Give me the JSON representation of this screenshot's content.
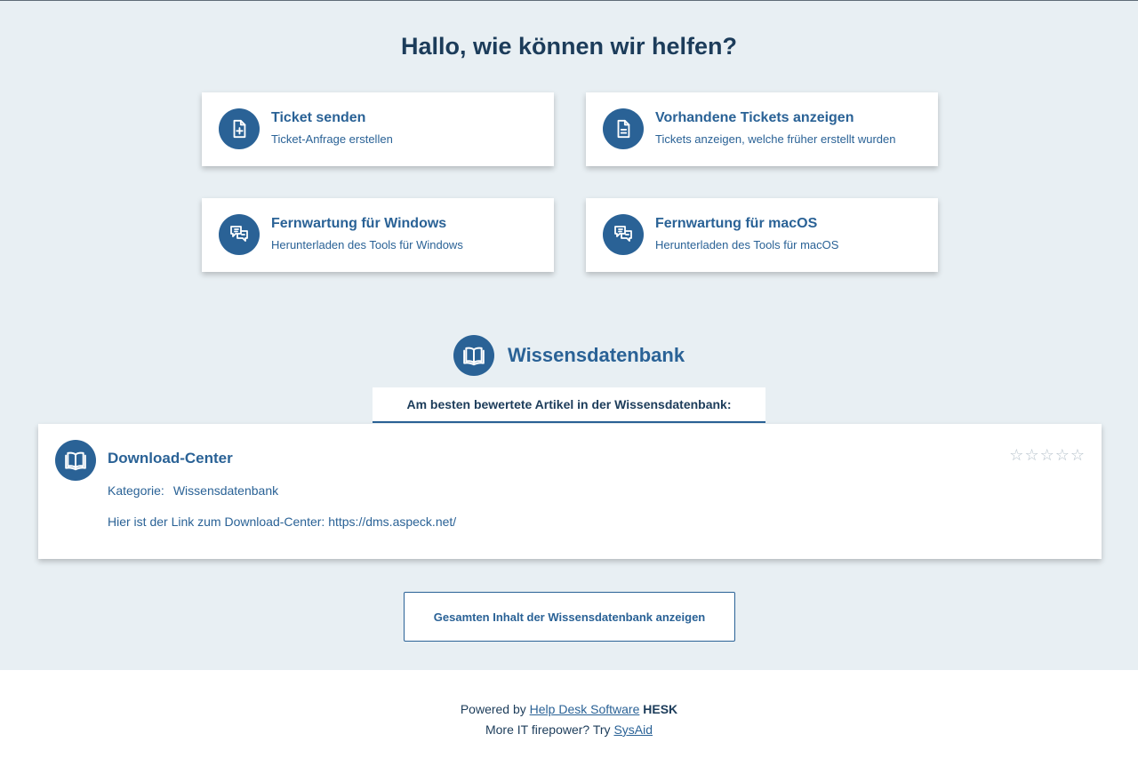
{
  "colors": {
    "primary": "#2a6296",
    "heading": "#1c3c5a",
    "background": "#e8eff3",
    "card": "#ffffff"
  },
  "page_title": "Hallo, wie können wir helfen?",
  "nav_cards": [
    {
      "icon": "file-plus-icon",
      "title": "Ticket senden",
      "subtitle": "Ticket-Anfrage erstellen"
    },
    {
      "icon": "file-text-icon",
      "title": "Vorhandene Tickets anzeigen",
      "subtitle": "Tickets anzeigen, welche früher erstellt wurden"
    },
    {
      "icon": "chat-bubbles-icon",
      "title": "Fernwartung für Windows",
      "subtitle": "Herunterladen des Tools für Windows"
    },
    {
      "icon": "chat-bubbles-icon",
      "title": "Fernwartung für macOS",
      "subtitle": "Herunterladen des Tools für macOS"
    }
  ],
  "knowledgebase": {
    "icon": "open-book-icon",
    "title": "Wissensdatenbank",
    "tab_label": "Am besten bewertete Artikel in der Wissensdatenbank:",
    "article": {
      "icon": "open-book-icon",
      "title": "Download-Center",
      "category_label": "Kategorie:",
      "category_value": "Wissensdatenbank",
      "text": "Hier ist der Link zum Download-Center: https://dms.aspeck.net/",
      "rating_stars_total": 5,
      "rating_stars_filled": 0,
      "star_glyph": "☆"
    },
    "view_all_label": "Gesamten Inhalt der Wissensdatenbank anzeigen"
  },
  "footer": {
    "powered_by": "Powered by",
    "help_desk_link": "Help Desk Software",
    "brand": "HESK",
    "more_text": "More IT firepower? Try",
    "sysaid_link": "SysAid"
  }
}
